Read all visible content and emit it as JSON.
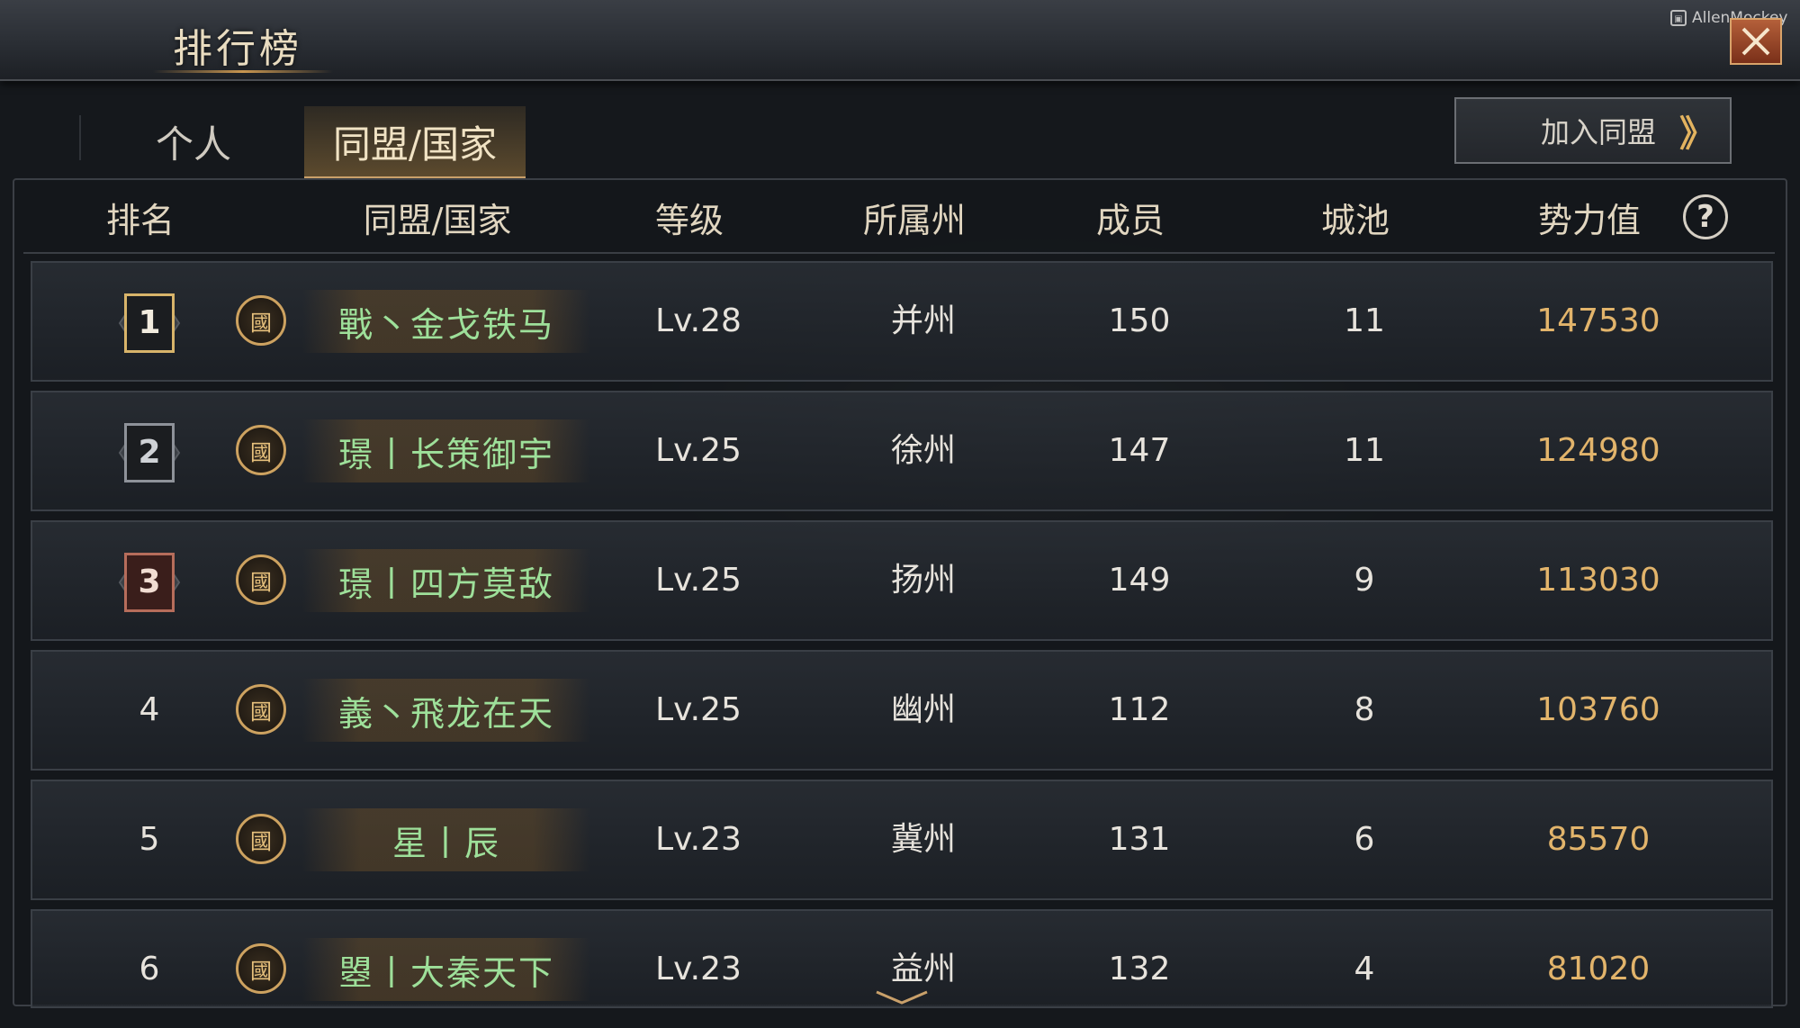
{
  "window": {
    "title": "排行榜",
    "watermark": "AllenMockey"
  },
  "tabs": [
    {
      "label": "个人",
      "active": false
    },
    {
      "label": "同盟/国家",
      "active": true
    }
  ],
  "join_button": {
    "label": "加入同盟",
    "chevron": "》"
  },
  "table": {
    "headers": [
      "排名",
      "同盟/国家",
      "等级",
      "所属州",
      "成员",
      "城池",
      "势力值"
    ],
    "help": "?",
    "emblem_glyph": "國",
    "rows": [
      {
        "rank": "1",
        "name": "戰丶金戈铁马",
        "level": "Lv.28",
        "state": "并州",
        "members": "150",
        "cities": "11",
        "power": "147530"
      },
      {
        "rank": "2",
        "name": "璟丨长策御宇",
        "level": "Lv.25",
        "state": "徐州",
        "members": "147",
        "cities": "11",
        "power": "124980"
      },
      {
        "rank": "3",
        "name": "璟丨四方莫敌",
        "level": "Lv.25",
        "state": "扬州",
        "members": "149",
        "cities": "9",
        "power": "113030"
      },
      {
        "rank": "4",
        "name": "義丶飛龙在天",
        "level": "Lv.25",
        "state": "幽州",
        "members": "112",
        "cities": "8",
        "power": "103760"
      },
      {
        "rank": "5",
        "name": "星丨辰",
        "level": "Lv.23",
        "state": "冀州",
        "members": "131",
        "cities": "6",
        "power": "85570"
      },
      {
        "rank": "6",
        "name": "曌丨大秦天下",
        "level": "Lv.23",
        "state": "益州",
        "members": "132",
        "cities": "4",
        "power": "81020"
      }
    ]
  },
  "colors": {
    "accent_gold": "#e2b46b",
    "name_green": "#9ee09a",
    "close_red": "#b4603a"
  }
}
